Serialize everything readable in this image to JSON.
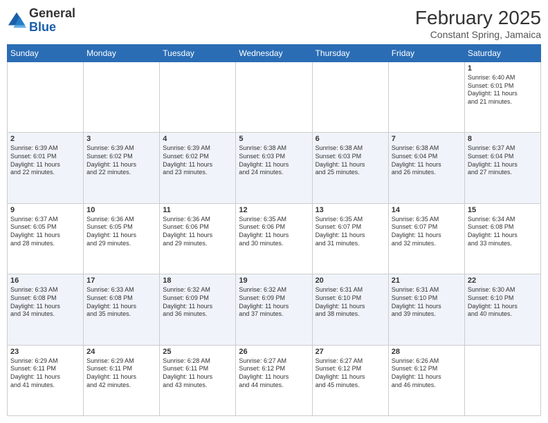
{
  "header": {
    "logo_general": "General",
    "logo_blue": "Blue",
    "month_title": "February 2025",
    "location": "Constant Spring, Jamaica"
  },
  "days_of_week": [
    "Sunday",
    "Monday",
    "Tuesday",
    "Wednesday",
    "Thursday",
    "Friday",
    "Saturday"
  ],
  "weeks": [
    [
      {
        "day": "",
        "detail": ""
      },
      {
        "day": "",
        "detail": ""
      },
      {
        "day": "",
        "detail": ""
      },
      {
        "day": "",
        "detail": ""
      },
      {
        "day": "",
        "detail": ""
      },
      {
        "day": "",
        "detail": ""
      },
      {
        "day": "1",
        "detail": "Sunrise: 6:40 AM\nSunset: 6:01 PM\nDaylight: 11 hours\nand 21 minutes."
      }
    ],
    [
      {
        "day": "2",
        "detail": "Sunrise: 6:39 AM\nSunset: 6:01 PM\nDaylight: 11 hours\nand 22 minutes."
      },
      {
        "day": "3",
        "detail": "Sunrise: 6:39 AM\nSunset: 6:02 PM\nDaylight: 11 hours\nand 22 minutes."
      },
      {
        "day": "4",
        "detail": "Sunrise: 6:39 AM\nSunset: 6:02 PM\nDaylight: 11 hours\nand 23 minutes."
      },
      {
        "day": "5",
        "detail": "Sunrise: 6:38 AM\nSunset: 6:03 PM\nDaylight: 11 hours\nand 24 minutes."
      },
      {
        "day": "6",
        "detail": "Sunrise: 6:38 AM\nSunset: 6:03 PM\nDaylight: 11 hours\nand 25 minutes."
      },
      {
        "day": "7",
        "detail": "Sunrise: 6:38 AM\nSunset: 6:04 PM\nDaylight: 11 hours\nand 26 minutes."
      },
      {
        "day": "8",
        "detail": "Sunrise: 6:37 AM\nSunset: 6:04 PM\nDaylight: 11 hours\nand 27 minutes."
      }
    ],
    [
      {
        "day": "9",
        "detail": "Sunrise: 6:37 AM\nSunset: 6:05 PM\nDaylight: 11 hours\nand 28 minutes."
      },
      {
        "day": "10",
        "detail": "Sunrise: 6:36 AM\nSunset: 6:05 PM\nDaylight: 11 hours\nand 29 minutes."
      },
      {
        "day": "11",
        "detail": "Sunrise: 6:36 AM\nSunset: 6:06 PM\nDaylight: 11 hours\nand 29 minutes."
      },
      {
        "day": "12",
        "detail": "Sunrise: 6:35 AM\nSunset: 6:06 PM\nDaylight: 11 hours\nand 30 minutes."
      },
      {
        "day": "13",
        "detail": "Sunrise: 6:35 AM\nSunset: 6:07 PM\nDaylight: 11 hours\nand 31 minutes."
      },
      {
        "day": "14",
        "detail": "Sunrise: 6:35 AM\nSunset: 6:07 PM\nDaylight: 11 hours\nand 32 minutes."
      },
      {
        "day": "15",
        "detail": "Sunrise: 6:34 AM\nSunset: 6:08 PM\nDaylight: 11 hours\nand 33 minutes."
      }
    ],
    [
      {
        "day": "16",
        "detail": "Sunrise: 6:33 AM\nSunset: 6:08 PM\nDaylight: 11 hours\nand 34 minutes."
      },
      {
        "day": "17",
        "detail": "Sunrise: 6:33 AM\nSunset: 6:08 PM\nDaylight: 11 hours\nand 35 minutes."
      },
      {
        "day": "18",
        "detail": "Sunrise: 6:32 AM\nSunset: 6:09 PM\nDaylight: 11 hours\nand 36 minutes."
      },
      {
        "day": "19",
        "detail": "Sunrise: 6:32 AM\nSunset: 6:09 PM\nDaylight: 11 hours\nand 37 minutes."
      },
      {
        "day": "20",
        "detail": "Sunrise: 6:31 AM\nSunset: 6:10 PM\nDaylight: 11 hours\nand 38 minutes."
      },
      {
        "day": "21",
        "detail": "Sunrise: 6:31 AM\nSunset: 6:10 PM\nDaylight: 11 hours\nand 39 minutes."
      },
      {
        "day": "22",
        "detail": "Sunrise: 6:30 AM\nSunset: 6:10 PM\nDaylight: 11 hours\nand 40 minutes."
      }
    ],
    [
      {
        "day": "23",
        "detail": "Sunrise: 6:29 AM\nSunset: 6:11 PM\nDaylight: 11 hours\nand 41 minutes."
      },
      {
        "day": "24",
        "detail": "Sunrise: 6:29 AM\nSunset: 6:11 PM\nDaylight: 11 hours\nand 42 minutes."
      },
      {
        "day": "25",
        "detail": "Sunrise: 6:28 AM\nSunset: 6:11 PM\nDaylight: 11 hours\nand 43 minutes."
      },
      {
        "day": "26",
        "detail": "Sunrise: 6:27 AM\nSunset: 6:12 PM\nDaylight: 11 hours\nand 44 minutes."
      },
      {
        "day": "27",
        "detail": "Sunrise: 6:27 AM\nSunset: 6:12 PM\nDaylight: 11 hours\nand 45 minutes."
      },
      {
        "day": "28",
        "detail": "Sunrise: 6:26 AM\nSunset: 6:12 PM\nDaylight: 11 hours\nand 46 minutes."
      },
      {
        "day": "",
        "detail": ""
      }
    ]
  ]
}
